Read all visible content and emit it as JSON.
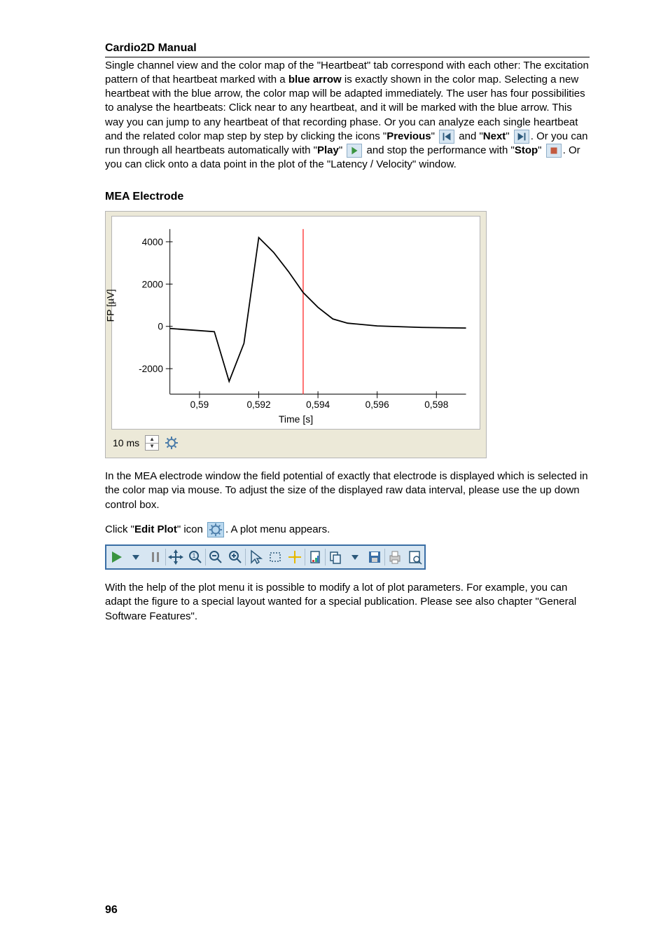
{
  "header": {
    "title": "Cardio2D Manual"
  },
  "para1_parts": {
    "a": "Single channel view and the color map of the  \"Heartbeat\" tab correspond with each other: The excitation pattern of that heartbeat marked with a ",
    "blue_arrow": "blue arrow",
    "b": " is exactly shown in the color map. Selecting a new heartbeat with the blue arrow, the color map will be adapted immediately. The user has four possibilities to analyse the heartbeats: Click near to any heartbeat, and it will be marked with the blue arrow. This way you can jump to any heartbeat of that recording phase. Or you can analyze each single heartbeat and the related color map step by step by clicking the icons \"",
    "previous": "Previous",
    "c": "\" ",
    "d": " and \"",
    "next": "Next",
    "e": "\" ",
    "f": ". Or you can run through all heartbeats automatically with \"",
    "play": "Play",
    "g": "\" ",
    "h": " and stop the performance with \"",
    "stop": "Stop",
    "i": "\" ",
    "j": ". Or you can click onto a data point in the plot of the \"Latency / Velocity\" window."
  },
  "section_mea": {
    "title": "MEA Electrode"
  },
  "chart_data": {
    "type": "line",
    "title": "",
    "xlabel": "Time [s]",
    "ylabel": "FP [µV]",
    "x_ticks": [
      "0,59",
      "0,592",
      "0,594",
      "0,596",
      "0,598"
    ],
    "y_ticks": [
      -2000,
      0,
      2000,
      4000
    ],
    "xlim": [
      0.589,
      0.599
    ],
    "ylim": [
      -3200,
      4600
    ],
    "series": [
      {
        "name": "FP",
        "color": "#000000",
        "x": [
          0.589,
          0.5905,
          0.591,
          0.5915,
          0.592,
          0.5925,
          0.593,
          0.5935,
          0.594,
          0.5945,
          0.595,
          0.596,
          0.5975,
          0.599
        ],
        "y": [
          -100,
          -250,
          -2600,
          -800,
          4200,
          3500,
          2600,
          1600,
          900,
          350,
          150,
          20,
          -50,
          -80
        ]
      }
    ],
    "marker": {
      "x": 0.5935,
      "ymin": -3200,
      "ymax": 4600,
      "color": "#ff4040"
    }
  },
  "chart_status": {
    "interval": "10 ms"
  },
  "para2": "In the MEA electrode window the field potential of exactly that electrode is displayed which is selected in the color map via mouse. To adjust the size of the displayed raw data interval, please use the up down control box.",
  "para3": {
    "a": "Click \"",
    "editplot": "Edit Plot",
    "b": "\" icon ",
    "c": ". A plot menu appears."
  },
  "para4": "With the help of the plot menu it is possible to modify a lot of plot parameters. For example, you can adapt the figure to a special layout wanted for a special publication. Please see also chapter \"General Software Features\".",
  "plotmenu": {
    "items": [
      "play-icon",
      "dropdown-icon",
      "pause-icon",
      "sep",
      "pan-icon",
      "zoom-reset-icon",
      "sep",
      "zoom-out-icon",
      "zoom-in-icon",
      "sep",
      "pointer-icon",
      "select-rect-icon",
      "annotate-icon",
      "sep",
      "clipboard-icon",
      "sep",
      "copy-icon",
      "dropdown2-icon",
      "save-icon",
      "sep",
      "print-icon",
      "preview-icon"
    ]
  },
  "page_number": "96"
}
